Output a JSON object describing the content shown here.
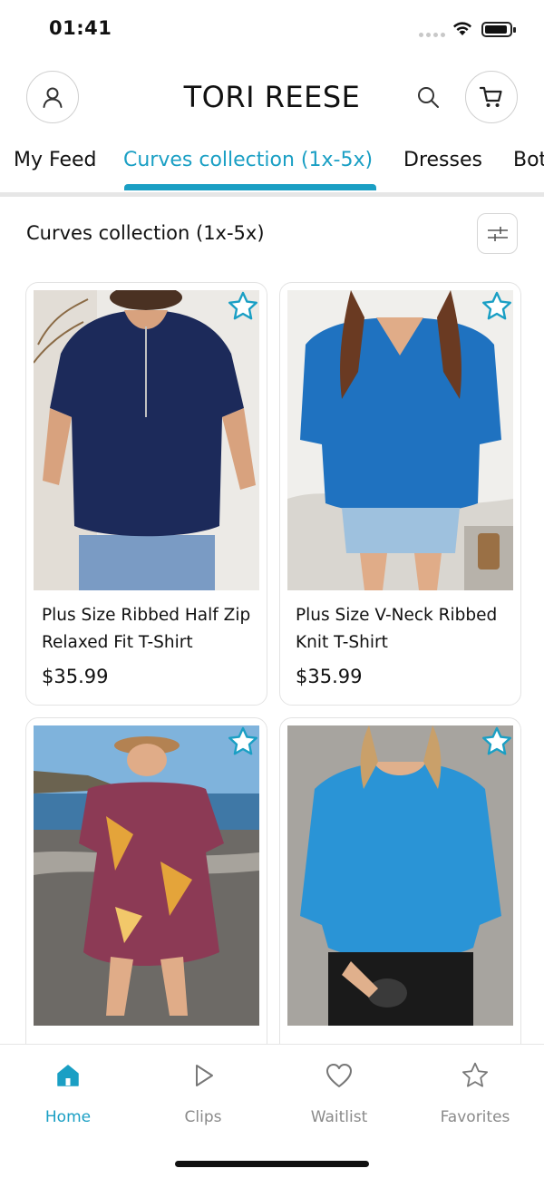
{
  "status": {
    "time": "01:41"
  },
  "header": {
    "brand": "TORI REESE"
  },
  "tabs": [
    {
      "label": "My Feed"
    },
    {
      "label": "Curves collection (1x-5x)"
    },
    {
      "label": "Dresses"
    },
    {
      "label": "Bot"
    }
  ],
  "section": {
    "title": "Curves collection (1x-5x)"
  },
  "products": [
    {
      "name": "Plus Size Ribbed Half Zip Relaxed Fit T-Shirt",
      "price": "$35.99"
    },
    {
      "name": "Plus Size V-Neck Ribbed Knit T-Shirt",
      "price": "$35.99"
    },
    {
      "name": "",
      "price": ""
    },
    {
      "name": "",
      "price": ""
    }
  ],
  "nav": [
    {
      "label": "Home"
    },
    {
      "label": "Clips"
    },
    {
      "label": "Waitlist"
    },
    {
      "label": "Favorites"
    }
  ],
  "colors": {
    "accent": "#1a9fc4"
  }
}
